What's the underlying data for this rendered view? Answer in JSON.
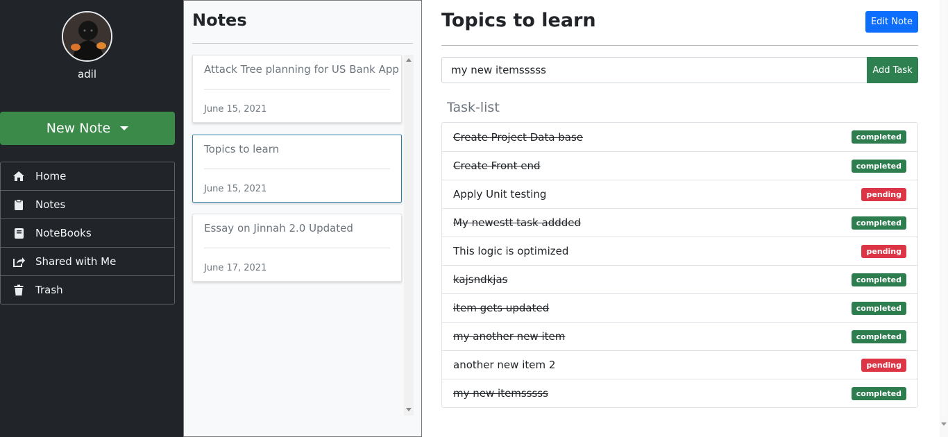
{
  "sidebar": {
    "user_name": "adil",
    "new_note_label": "New Note",
    "nav": [
      {
        "label": "Home",
        "icon": "home-icon"
      },
      {
        "label": "Notes",
        "icon": "clipboard-icon"
      },
      {
        "label": "NoteBooks",
        "icon": "book-icon"
      },
      {
        "label": "Shared with Me",
        "icon": "share-icon"
      },
      {
        "label": "Trash",
        "icon": "trash-icon"
      }
    ]
  },
  "notes_panel": {
    "title": "Notes",
    "notes": [
      {
        "title": "Attack Tree planning for US Bank App",
        "date": "June 15, 2021"
      },
      {
        "title": "Topics to learn",
        "date": "June 15, 2021",
        "selected": true
      },
      {
        "title": "Essay on Jinnah 2.0 Updated",
        "date": "June 17, 2021"
      }
    ]
  },
  "main": {
    "title": "Topics to learn",
    "edit_label": "Edit Note",
    "task_input_value": "my new itemsssss",
    "add_task_label": "Add Task",
    "tasklist_title": "Task-list",
    "tasks": [
      {
        "text": "Create Project Data base",
        "status": "completed"
      },
      {
        "text": "Create Front end",
        "status": "completed"
      },
      {
        "text": "Apply Unit testing",
        "status": "pending"
      },
      {
        "text": "My newestt task addded",
        "status": "completed"
      },
      {
        "text": "This logic is optimized",
        "status": "pending"
      },
      {
        "text": "kajsndkjas",
        "status": "completed"
      },
      {
        "text": "item gets updated",
        "status": "completed"
      },
      {
        "text": "my another new item",
        "status": "completed"
      },
      {
        "text": "another new item 2",
        "status": "pending"
      },
      {
        "text": "my new itemsssss",
        "status": "completed"
      }
    ]
  },
  "colors": {
    "sidebar_bg": "#212529",
    "new_note_green": "#3b8a4a",
    "primary_blue": "#0d6efd",
    "add_green": "#2f8050",
    "completed_badge": "#2e7d4f",
    "pending_badge": "#dc3545"
  }
}
